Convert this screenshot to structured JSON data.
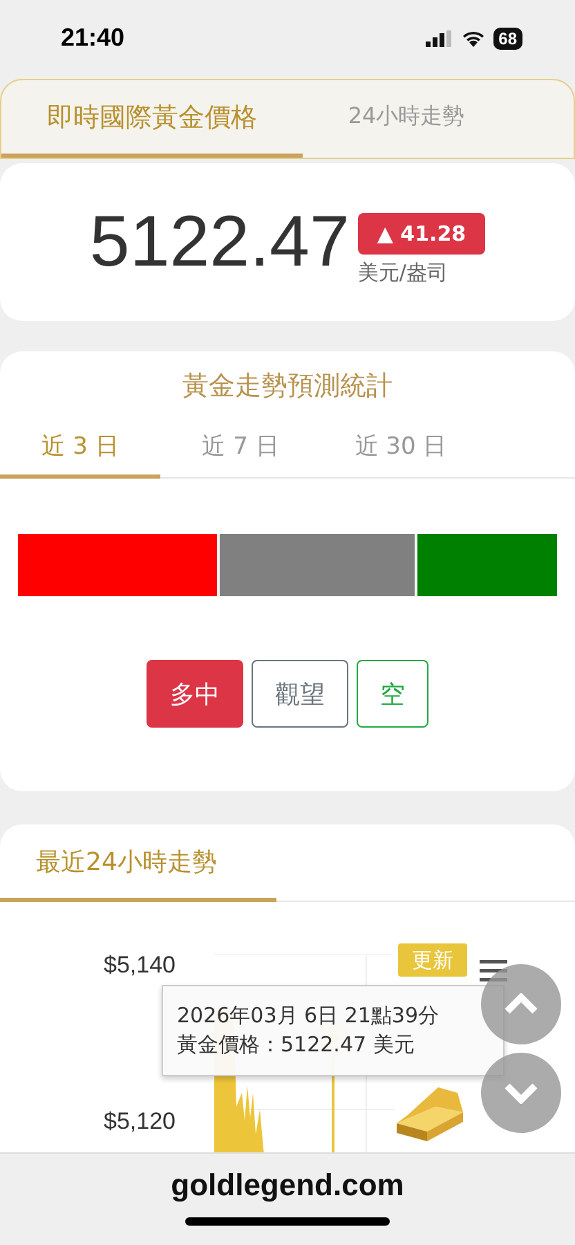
{
  "status_bar": {
    "time": "21:40",
    "battery": "68"
  },
  "top_tabs": [
    {
      "label": "即時國際黃金價格",
      "selected": true
    },
    {
      "label": "24小時走勢",
      "selected": false
    }
  ],
  "price": {
    "value": "5122.47",
    "change": "▲ 41.28",
    "unit": "美元/盎司"
  },
  "forecast": {
    "title": "黃金走勢預測統計",
    "tabs": [
      {
        "label": "近 3 日",
        "selected": true
      },
      {
        "label": "近 7 日",
        "selected": false
      },
      {
        "label": "近 30 日",
        "selected": false
      }
    ],
    "segments": [
      {
        "level": 0.37,
        "color": "#ff0000"
      },
      {
        "color": "#808080"
      },
      {
        "level": 0.26,
        "color": "#008000"
      }
    ],
    "buttons": [
      {
        "label": "多中",
        "color": "#dc3545",
        "selected": true
      },
      {
        "label": "觀望",
        "color": "#6c757d",
        "selected": false
      },
      {
        "label": "空",
        "color": "#28a745",
        "selected": false
      }
    ]
  },
  "trend": {
    "tab": {
      "label": "最近24小時走勢",
      "selected": true
    },
    "y_ticks": [
      "$5,140",
      "$5,120"
    ],
    "refresh_button": "更新",
    "tooltip": {
      "line_1": "2026年03月 6日 21點39分",
      "line_2": "黃金價格：5122.47 美元"
    }
  },
  "footer": {
    "site": "goldlegend.com"
  }
}
